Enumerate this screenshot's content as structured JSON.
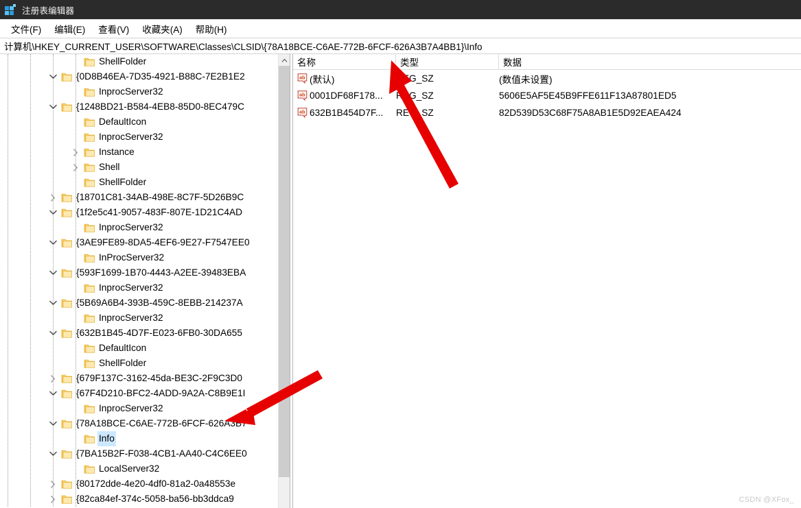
{
  "window": {
    "title": "注册表编辑器",
    "icon": "registry-editor-icon"
  },
  "menu": {
    "items": [
      {
        "label": "文件(F)",
        "name": "menu-file"
      },
      {
        "label": "编辑(E)",
        "name": "menu-edit"
      },
      {
        "label": "查看(V)",
        "name": "menu-view"
      },
      {
        "label": "收藏夹(A)",
        "name": "menu-favorites"
      },
      {
        "label": "帮助(H)",
        "name": "menu-help"
      }
    ]
  },
  "address": {
    "path": "计算机\\HKEY_CURRENT_USER\\SOFTWARE\\Classes\\CLSID\\{78A18BCE-C6AE-772B-6FCF-626A3B7A4BB1}\\Info"
  },
  "tree": {
    "nodes": [
      {
        "label": "ShellFolder",
        "depth": 7,
        "expander": "none",
        "selected": false
      },
      {
        "label": "{0D8B46EA-7D35-4921-B88C-7E2B1E2",
        "depth": 6,
        "expander": "expanded",
        "selected": false
      },
      {
        "label": "InprocServer32",
        "depth": 7,
        "expander": "none",
        "selected": false
      },
      {
        "label": "{1248BD21-B584-4EB8-85D0-8EC479C",
        "depth": 6,
        "expander": "expanded",
        "selected": false
      },
      {
        "label": "DefaultIcon",
        "depth": 7,
        "expander": "none",
        "selected": false
      },
      {
        "label": "InprocServer32",
        "depth": 7,
        "expander": "none",
        "selected": false
      },
      {
        "label": "Instance",
        "depth": 7,
        "expander": "collapsed",
        "selected": false
      },
      {
        "label": "Shell",
        "depth": 7,
        "expander": "collapsed",
        "selected": false
      },
      {
        "label": "ShellFolder",
        "depth": 7,
        "expander": "none",
        "selected": false
      },
      {
        "label": "{18701C81-34AB-498E-8C7F-5D26B9C",
        "depth": 6,
        "expander": "collapsed",
        "selected": false
      },
      {
        "label": "{1f2e5c41-9057-483F-807E-1D21C4AD",
        "depth": 6,
        "expander": "expanded",
        "selected": false
      },
      {
        "label": "InprocServer32",
        "depth": 7,
        "expander": "none",
        "selected": false
      },
      {
        "label": "{3AE9FE89-8DA5-4EF6-9E27-F7547EE0",
        "depth": 6,
        "expander": "expanded",
        "selected": false
      },
      {
        "label": "InProcServer32",
        "depth": 7,
        "expander": "none",
        "selected": false
      },
      {
        "label": "{593F1699-1B70-4443-A2EE-39483EBA",
        "depth": 6,
        "expander": "expanded",
        "selected": false
      },
      {
        "label": "InprocServer32",
        "depth": 7,
        "expander": "none",
        "selected": false
      },
      {
        "label": "{5B69A6B4-393B-459C-8EBB-214237A",
        "depth": 6,
        "expander": "expanded",
        "selected": false
      },
      {
        "label": "InprocServer32",
        "depth": 7,
        "expander": "none",
        "selected": false
      },
      {
        "label": "{632B1B45-4D7F-E023-6FB0-30DA655",
        "depth": 6,
        "expander": "expanded",
        "selected": false
      },
      {
        "label": "DefaultIcon",
        "depth": 7,
        "expander": "none",
        "selected": false
      },
      {
        "label": "ShellFolder",
        "depth": 7,
        "expander": "none",
        "selected": false
      },
      {
        "label": "{679F137C-3162-45da-BE3C-2F9C3D0",
        "depth": 6,
        "expander": "collapsed",
        "selected": false
      },
      {
        "label": "{67F4D210-BFC2-4ADD-9A2A-C8B9E1I",
        "depth": 6,
        "expander": "expanded",
        "selected": false
      },
      {
        "label": "InprocServer32",
        "depth": 7,
        "expander": "none",
        "selected": false
      },
      {
        "label": "{78A18BCE-C6AE-772B-6FCF-626A3B7",
        "depth": 6,
        "expander": "expanded",
        "selected": false
      },
      {
        "label": "Info",
        "depth": 7,
        "expander": "none",
        "selected": true
      },
      {
        "label": "{7BA15B2F-F038-4CB1-AA40-C4C6EE0",
        "depth": 6,
        "expander": "expanded",
        "selected": false
      },
      {
        "label": "LocalServer32",
        "depth": 7,
        "expander": "none",
        "selected": false
      },
      {
        "label": "{80172dde-4e20-4df0-81a2-0a48553e",
        "depth": 6,
        "expander": "collapsed",
        "selected": false
      },
      {
        "label": "{82ca84ef-374c-5058-ba56-bb3ddca9",
        "depth": 6,
        "expander": "collapsed",
        "selected": false
      }
    ]
  },
  "list": {
    "columns": [
      {
        "label": "名称",
        "name": "column-name"
      },
      {
        "label": "类型",
        "name": "column-type"
      },
      {
        "label": "数据",
        "name": "column-data"
      }
    ],
    "rows": [
      {
        "name": "(默认)",
        "type": "REG_SZ",
        "data": "(数值未设置)"
      },
      {
        "name": "0001DF68F178...",
        "type": "REG_SZ",
        "data": "5606E5AF5E45B9FFE611F13A87801ED5"
      },
      {
        "name": "632B1B454D7F...",
        "type": "REG_SZ",
        "data": "82D539D53C68F75A8AB1E5D92EAEA424"
      }
    ]
  },
  "annotations": {
    "arrow_color": "#e60000",
    "arrow_top_label": "arrow-pointing-to-address-bar",
    "arrow_bottom_label": "arrow-pointing-to-clsid-key"
  },
  "watermark": {
    "text": "CSDN @XFox_"
  }
}
